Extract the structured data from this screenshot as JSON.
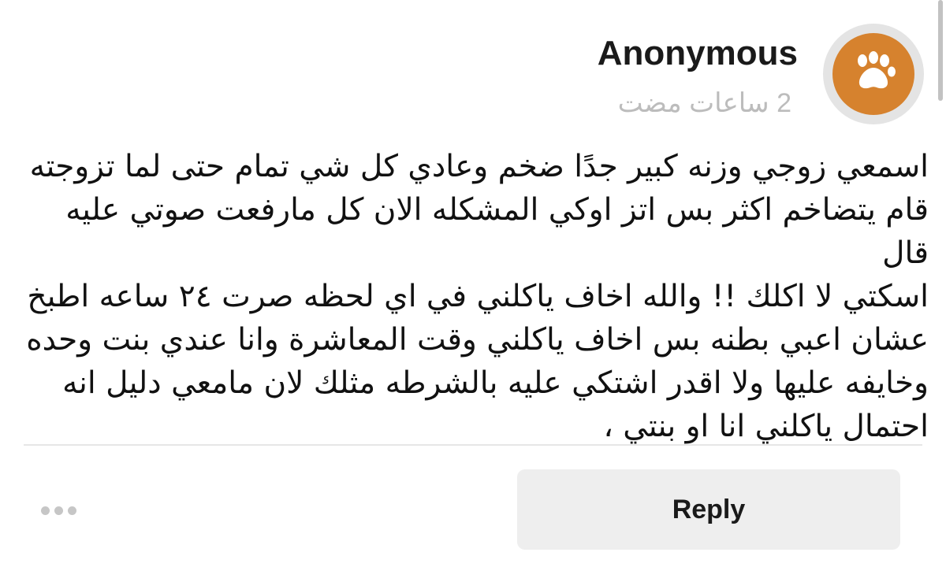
{
  "post": {
    "author": "Anonymous",
    "time_ago": "2 ساعات مضت",
    "avatar_icon": "paw-icon",
    "avatar_color": "#d6822e",
    "body_lines": [
      "اسمعي زوجي وزنه كبير جدًا ضخم وعادي كل شي تمام حتى لما تزوجته",
      "قام يتضاخم اكثر بس اتز اوكي المشكله الان كل مارفعت صوتي عليه قال",
      "اسكتي لا اكلك !! والله اخاف ياكلني في اي لحظه صرت ٢٤ ساعه اطبخ",
      "عشان اعبي بطنه بس اخاف ياكلني وقت المعاشرة وانا عندي بنت وحده",
      "وخايفه عليها ولا اقدر اشتكي عليه بالشرطه مثلك لان مامعي دليل انه",
      "احتمال ياكلني انا او بنتي ،"
    ]
  },
  "actions": {
    "more_icon": "more-dots-icon",
    "reply_label": "Reply"
  }
}
